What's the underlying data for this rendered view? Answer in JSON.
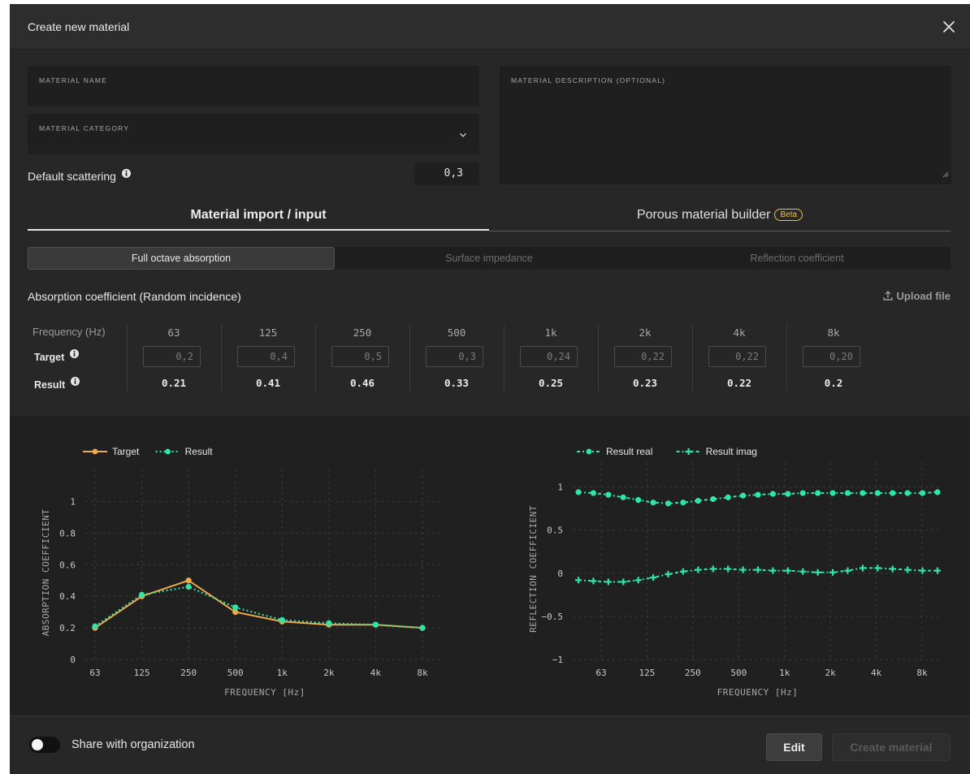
{
  "dialog": {
    "title": "Create new material"
  },
  "form": {
    "name_label": "MATERIAL NAME",
    "name_value": "",
    "category_label": "MATERIAL CATEGORY",
    "category_value": "",
    "description_label": "MATERIAL DESCRIPTION (OPTIONAL)",
    "description_value": "",
    "scattering_label": "Default scattering",
    "scattering_value": "0,3"
  },
  "tabs": {
    "import_label": "Material import / input",
    "porous_label": "Porous material builder",
    "beta_badge": "Beta",
    "active": "import"
  },
  "segments": [
    {
      "label": "Full octave absorption",
      "active": true
    },
    {
      "label": "Surface impedance",
      "active": false
    },
    {
      "label": "Reflection coefficient",
      "active": false
    }
  ],
  "absorption": {
    "title": "Absorption coefficient (Random incidence)",
    "upload_label": "Upload file",
    "freq_label": "Frequency (Hz)",
    "target_label": "Target",
    "result_label": "Result",
    "frequencies": [
      "63",
      "125",
      "250",
      "500",
      "1k",
      "2k",
      "4k",
      "8k"
    ],
    "targets": [
      "0,2",
      "0,4",
      "0,5",
      "0,3",
      "0,24",
      "0,22",
      "0,22",
      "0,20"
    ],
    "results": [
      "0.21",
      "0.41",
      "0.46",
      "0.33",
      "0.25",
      "0.23",
      "0.22",
      "0.2"
    ]
  },
  "colors": {
    "target": "#f0a848",
    "result": "#2ee6a8",
    "accent": "#f0c043"
  },
  "chart_data": [
    {
      "type": "line",
      "xlabel": "FREQUENCY [Hz]",
      "ylabel": "ABSORPTION COEFFICIENT",
      "categories": [
        "63",
        "125",
        "250",
        "500",
        "1k",
        "2k",
        "4k",
        "8k"
      ],
      "ylim": [
        0,
        1.1
      ],
      "yticks": [
        "0",
        "0.2",
        "0.4",
        "0.6",
        "0.8",
        "1"
      ],
      "grid": true,
      "legend": "top-left",
      "series": [
        {
          "name": "Target",
          "style": "solid",
          "values": [
            0.2,
            0.4,
            0.5,
            0.3,
            0.24,
            0.22,
            0.22,
            0.2
          ]
        },
        {
          "name": "Result",
          "style": "dotted",
          "values": [
            0.21,
            0.41,
            0.46,
            0.33,
            0.25,
            0.23,
            0.22,
            0.2
          ]
        }
      ]
    },
    {
      "type": "line",
      "xlabel": "FREQUENCY [Hz]",
      "ylabel": "REFLECTION COEFFICIENT",
      "categories": [
        "63",
        "125",
        "250",
        "500",
        "1k",
        "2k",
        "4k",
        "8k"
      ],
      "yticks": [
        "−1",
        "−0.5",
        "0",
        "0.5",
        "1"
      ],
      "ylim": [
        -1,
        1.1
      ],
      "grid": true,
      "legend": "top-left",
      "series": [
        {
          "name": "Result real",
          "marker": "dot",
          "values": [
            0.94,
            0.93,
            0.91,
            0.88,
            0.85,
            0.82,
            0.81,
            0.82,
            0.84,
            0.86,
            0.88,
            0.9,
            0.91,
            0.92,
            0.92,
            0.93,
            0.93,
            0.93,
            0.93,
            0.93,
            0.93,
            0.93,
            0.93,
            0.93,
            0.94
          ]
        },
        {
          "name": "Result imag",
          "marker": "plus",
          "values": [
            -0.08,
            -0.09,
            -0.1,
            -0.1,
            -0.08,
            -0.05,
            -0.01,
            0.02,
            0.04,
            0.05,
            0.05,
            0.04,
            0.04,
            0.03,
            0.03,
            0.02,
            0.01,
            0.01,
            0.03,
            0.06,
            0.06,
            0.05,
            0.04,
            0.03,
            0.03
          ]
        }
      ]
    }
  ],
  "footer": {
    "share_label": "Share with organization",
    "share_on": false,
    "edit_label": "Edit",
    "create_label": "Create material"
  }
}
